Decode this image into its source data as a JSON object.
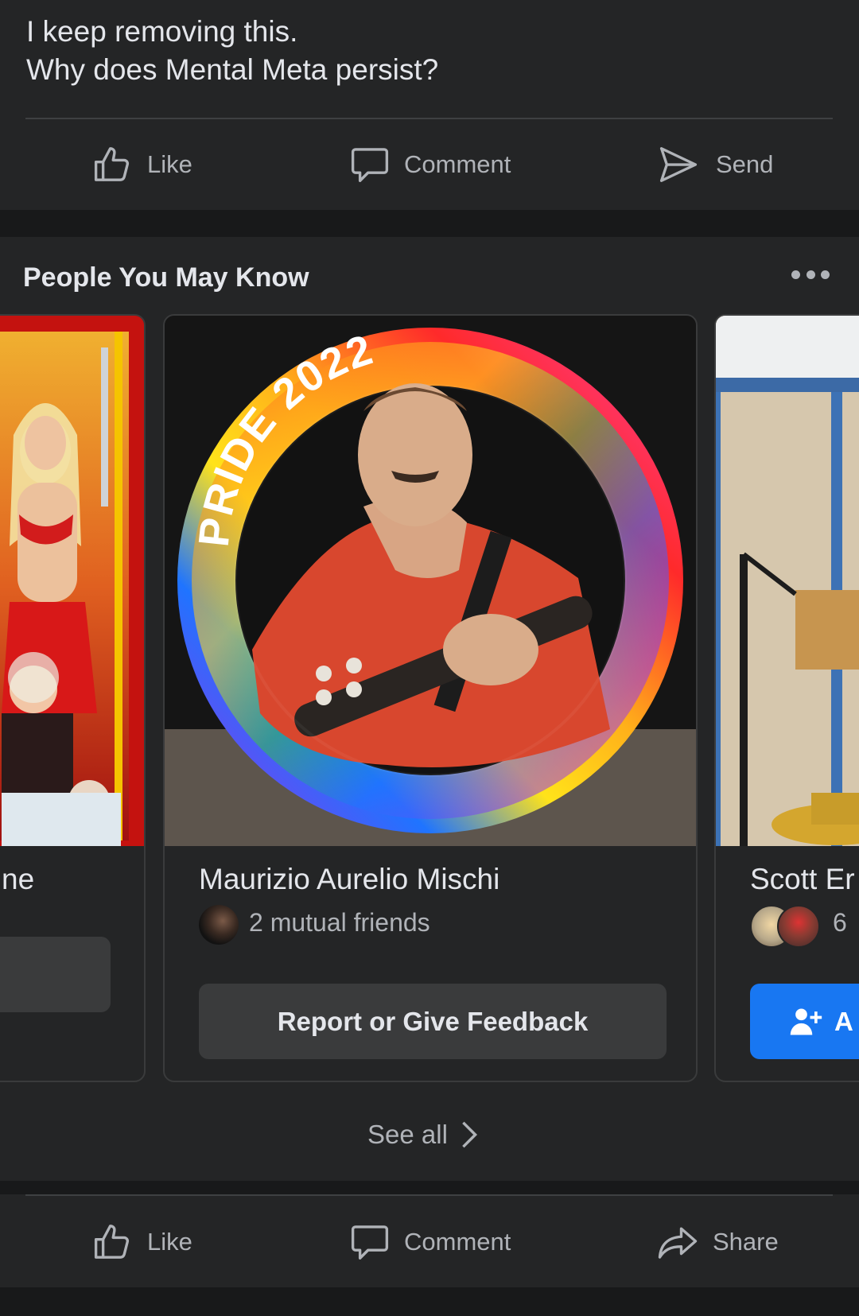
{
  "post": {
    "text_line1": "I keep removing this.",
    "text_line2": "Why does Mental Meta persist?",
    "actions": {
      "like": "Like",
      "comment": "Comment",
      "send": "Send"
    }
  },
  "pymk": {
    "title": "People You May Know",
    "cards": [
      {
        "name_fragment": "ne"
      },
      {
        "name": "Maurizio Aurelio Mischi",
        "mutual": "2 mutual friends",
        "photo_frame_text": "PRIDE 2022",
        "button": "Report or Give Feedback"
      },
      {
        "name_fragment": "Scott Er",
        "mutual_fragment": "6",
        "button_fragment": "A"
      }
    ],
    "see_all": "See all"
  },
  "footer_actions": {
    "like": "Like",
    "comment": "Comment",
    "share": "Share"
  },
  "colors": {
    "background": "#18191a",
    "panel": "#242526",
    "text_primary": "#e4e6eb",
    "text_secondary": "#b0b3b8",
    "button_gray": "#3a3b3c",
    "button_blue": "#1877f2"
  },
  "icons": [
    "thumbs-up-icon",
    "comment-bubble-icon",
    "send-arrow-icon",
    "more-dots-icon",
    "chevron-right-icon",
    "share-arrow-icon",
    "add-friend-icon"
  ]
}
